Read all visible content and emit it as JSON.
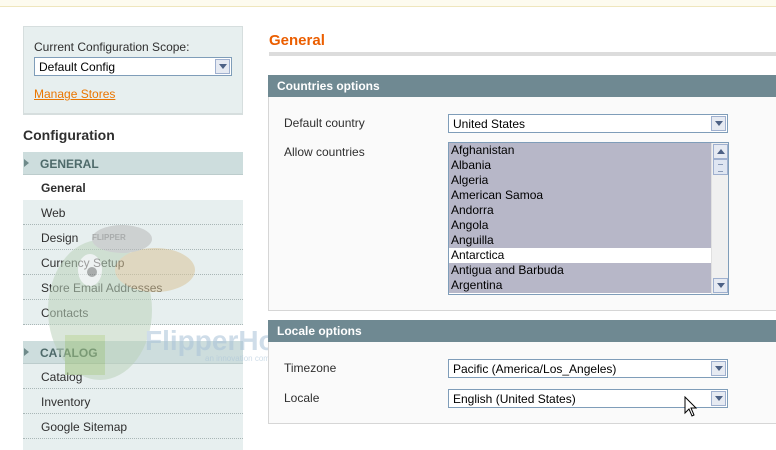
{
  "scope": {
    "label": "Current Configuration Scope:",
    "selected": "Default Config",
    "manage_link": "Manage Stores"
  },
  "sidebar": {
    "title": "Configuration",
    "groups": [
      {
        "label": "GENERAL",
        "items": [
          {
            "label": "General",
            "active": true
          },
          {
            "label": "Web"
          },
          {
            "label": "Design"
          },
          {
            "label": "Currency Setup"
          },
          {
            "label": "Store Email Addresses"
          },
          {
            "label": "Contacts"
          }
        ]
      },
      {
        "label": "CATALOG",
        "items": [
          {
            "label": "Catalog"
          },
          {
            "label": "Inventory"
          },
          {
            "label": "Google Sitemap"
          }
        ]
      }
    ]
  },
  "watermark": {
    "brand": "FlipperHost",
    "tagline": "an innovation company",
    "badge": "FLIPPER"
  },
  "main": {
    "title": "General",
    "countries_section": {
      "title": "Countries options",
      "default_country_label": "Default country",
      "default_country_value": "United States",
      "allow_countries_label": "Allow countries",
      "countries": [
        {
          "name": "Afghanistan",
          "selected": true
        },
        {
          "name": "Albania",
          "selected": true
        },
        {
          "name": "Algeria",
          "selected": true
        },
        {
          "name": "American Samoa",
          "selected": true
        },
        {
          "name": "Andorra",
          "selected": true
        },
        {
          "name": "Angola",
          "selected": true
        },
        {
          "name": "Anguilla",
          "selected": true
        },
        {
          "name": "Antarctica",
          "selected": false
        },
        {
          "name": "Antigua and Barbuda",
          "selected": true
        },
        {
          "name": "Argentina",
          "selected": true
        }
      ]
    },
    "locale_section": {
      "title": "Locale options",
      "timezone_label": "Timezone",
      "timezone_value": "Pacific (America/Los_Angeles)",
      "locale_label": "Locale",
      "locale_value": "English (United States)"
    }
  },
  "colors": {
    "accent": "#eb5e00",
    "section_header": "#6f8992",
    "sidebar_bg": "#e7efef",
    "selection": "#b7b7c8"
  }
}
